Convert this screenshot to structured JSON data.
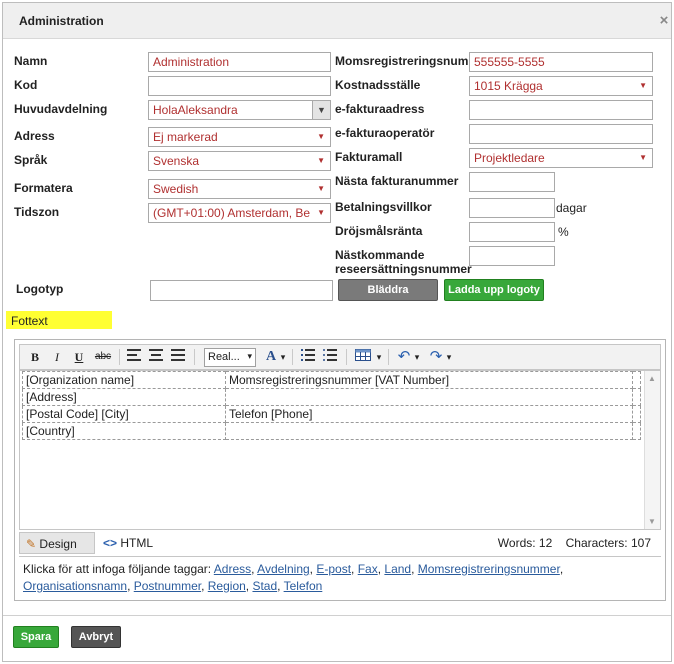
{
  "dialog": {
    "title": "Administration",
    "close_glyph": "×"
  },
  "left": {
    "labels": {
      "name": "Namn",
      "code": "Kod",
      "main_dept": "Huvudavdelning",
      "address": "Adress",
      "language": "Språk",
      "format": "Formatera",
      "timezone": "Tidszon",
      "logo": "Logotyp"
    },
    "values": {
      "name": "Administration",
      "code": "",
      "main_dept": "HolaAleksandra",
      "address": "Ej markerad",
      "language": "Svenska",
      "format": "Swedish",
      "timezone": "(GMT+01:00) Amsterdam, Be",
      "logo": ""
    }
  },
  "right": {
    "labels": {
      "vat": "Momsregistreringsnum",
      "cost_center": "Kostnadsställe",
      "einvoice_address": "e-fakturaadress",
      "einvoice_operator": "e-fakturaoperatör",
      "invoice_template": "Fakturamall",
      "next_invoice": "Nästa fakturanummer",
      "payment_terms": "Betalningsvillkor",
      "late_interest": "Dröjsmålsränta",
      "next_reimb_line1": "Nästkommande",
      "next_reimb_line2": "reseersättningsnummer"
    },
    "values": {
      "vat": "555555-5555",
      "cost_center": "1015 Krägga",
      "einvoice_address": "",
      "einvoice_operator": "",
      "invoice_template": "Projektledare",
      "next_invoice": "",
      "payment_terms": "",
      "late_interest": "",
      "next_reimb": ""
    },
    "units": {
      "days": "dagar",
      "percent": "%"
    }
  },
  "buttons": {
    "browse": "Bläddra",
    "upload_logo": "Ladda upp logoty",
    "save": "Spara",
    "cancel": "Avbryt"
  },
  "footer_section": {
    "label": "Fottext"
  },
  "editor": {
    "toolbar": {
      "bold": "B",
      "italic": "I",
      "underline": "U",
      "strike": "abc",
      "font": "Real...",
      "font_color": "A",
      "arrow": "▾"
    },
    "table": [
      [
        "[Organization name]",
        "Momsregistreringsnummer [VAT Number]"
      ],
      [
        "[Address]",
        ""
      ],
      [
        "[Postal Code] [City]",
        "Telefon [Phone]"
      ],
      [
        "[Country]",
        ""
      ]
    ],
    "tabs": {
      "design": "Design",
      "html": "HTML"
    },
    "word_count": "Words: 12",
    "char_count": "Characters: 107",
    "tags_intro": "Klicka för att infoga följande taggar:",
    "tags": [
      "Adress",
      "Avdelning",
      "E-post",
      "Fax",
      "Land",
      "Momsregistreringsnummer",
      "Organisationsnamn",
      "Postnummer",
      "Region",
      "Stad",
      "Telefon"
    ]
  },
  "colors": {
    "accent_green": "#38a83a",
    "value_red": "#b03030",
    "highlight_yellow": "#ffff33"
  }
}
